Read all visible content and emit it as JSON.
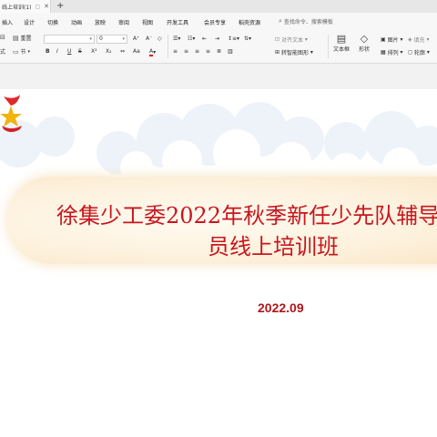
{
  "tabbar": {
    "doc_tab": "线上培训(1)",
    "add": "+"
  },
  "menu": {
    "items": [
      "插入",
      "设计",
      "切换",
      "动画",
      "放映",
      "审阅",
      "视图",
      "开发工具",
      "会员专享",
      "稻壳资源"
    ],
    "search_placeholder": "查找命令、搜索模板"
  },
  "ribbon": {
    "reset": "重置",
    "section": "节",
    "font_size": "0",
    "format": "式",
    "bold": "B",
    "italic": "I",
    "underline": "U",
    "strike": "S",
    "superscript": "X²",
    "subscript": "X₂",
    "align_text": "对齐文本",
    "convert_smartart": "转智能图形",
    "textbox": "文本框",
    "shape": "形状",
    "picture": "图片",
    "arrange": "排列",
    "fill": "填充",
    "outline": "轮廓"
  },
  "colors": {
    "title_red": "#c8161d",
    "banner": "#fdf1dc"
  },
  "slide": {
    "title_line1": "徐集少工委2022年秋季新任少先队辅导",
    "title_line2": "员线上培训班",
    "date": "2022.09"
  }
}
